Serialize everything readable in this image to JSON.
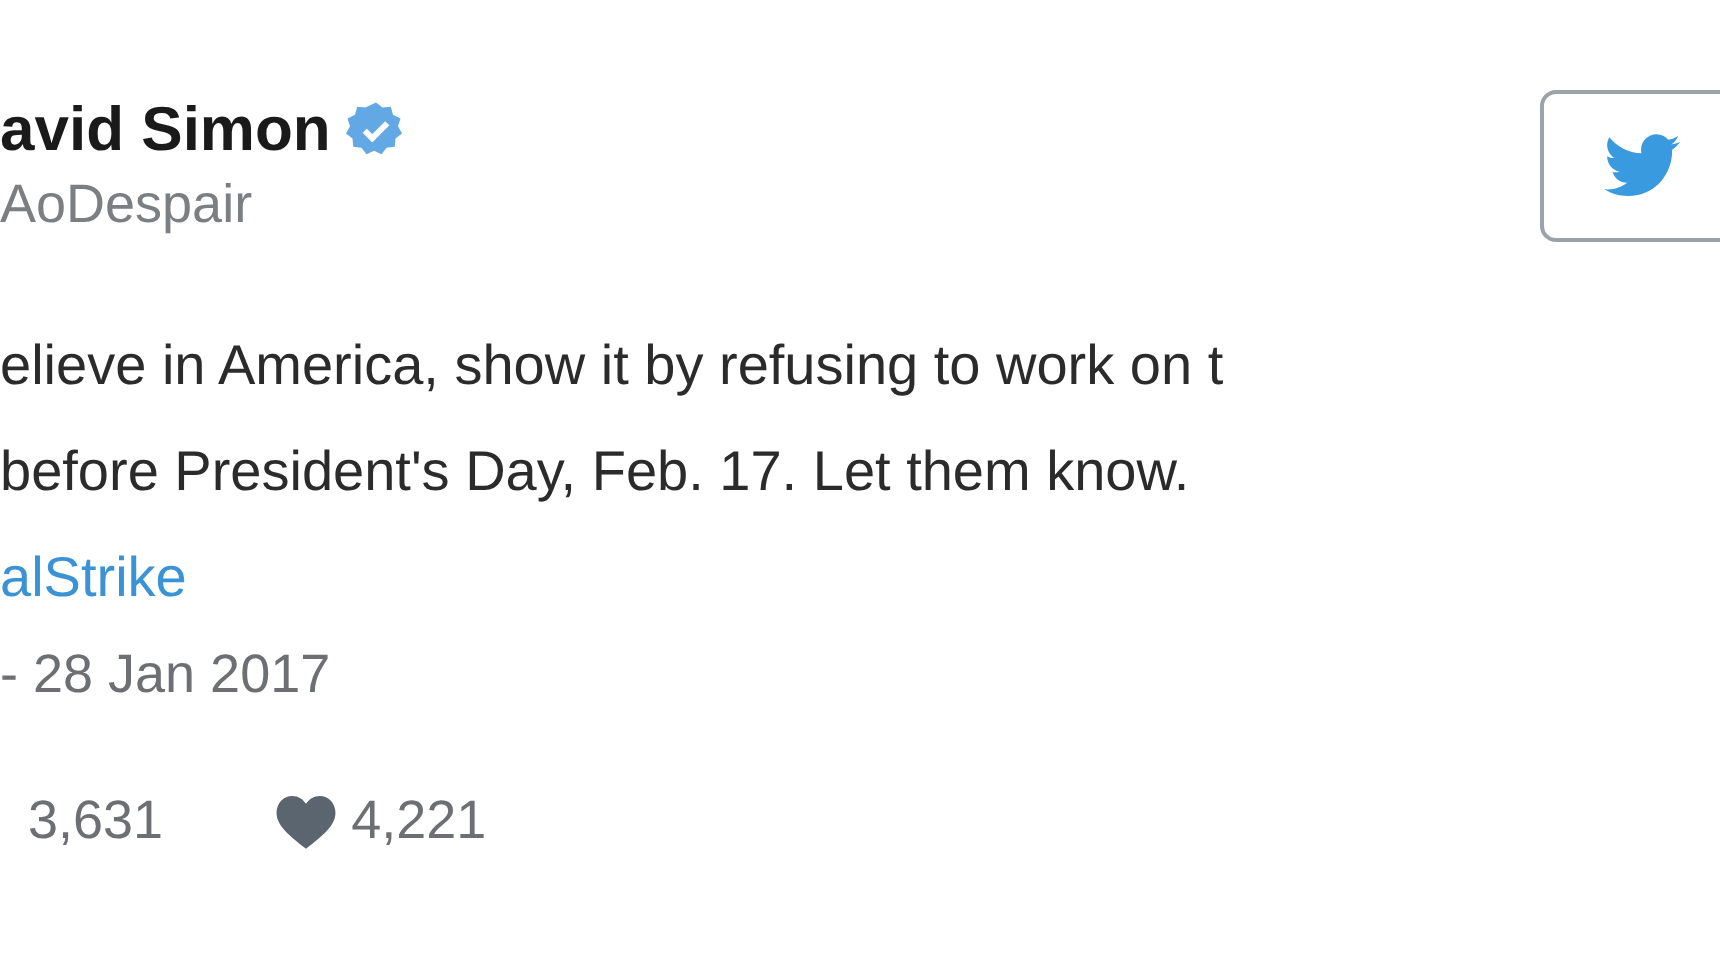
{
  "author": {
    "name": "avid Simon",
    "verified": true,
    "handle": "AoDespair"
  },
  "tweet_lines": [
    "elieve in America, show it by refusing to work on t",
    "before President's Day, Feb. 17. Let them know."
  ],
  "hashtag": "alStrike",
  "timestamp": "- 28 Jan 2017",
  "stats": [
    {
      "kind": "retweet",
      "count": "3,631"
    },
    {
      "kind": "like",
      "count": "4,221"
    }
  ]
}
